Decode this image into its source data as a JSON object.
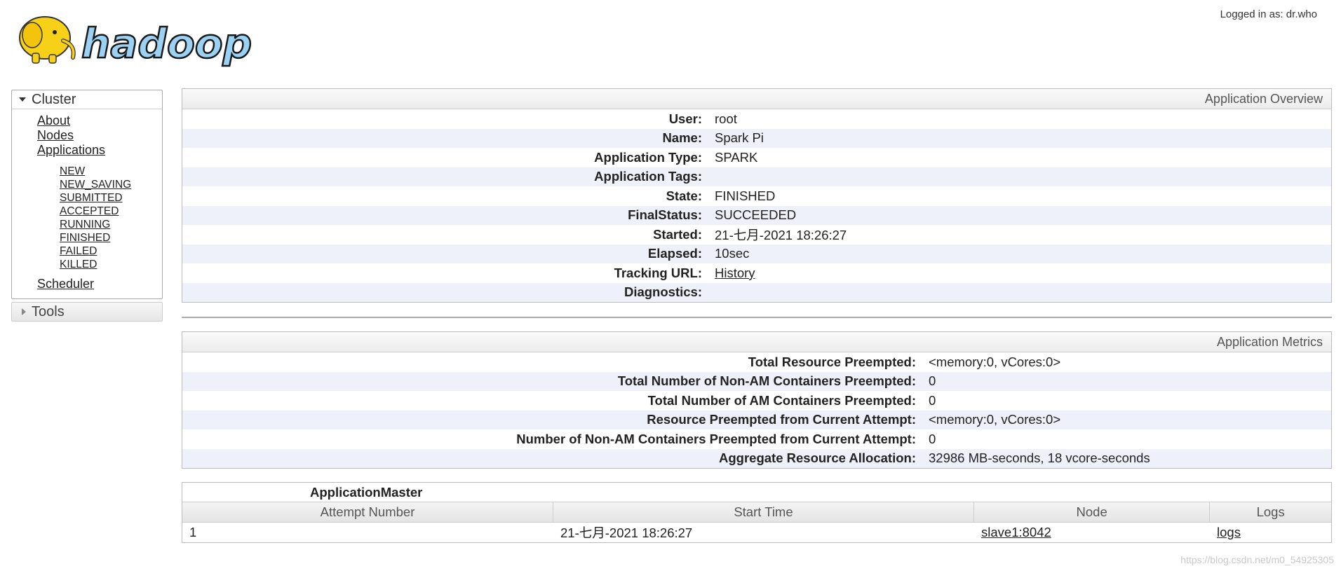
{
  "header": {
    "logo_text": "hadoop",
    "logged_in": "Logged in as: dr.who"
  },
  "nav": {
    "cluster": {
      "title": "Cluster",
      "links": [
        "About",
        "Nodes",
        "Applications"
      ],
      "states": [
        "NEW",
        "NEW_SAVING",
        "SUBMITTED",
        "ACCEPTED",
        "RUNNING",
        "FINISHED",
        "FAILED",
        "KILLED"
      ],
      "scheduler": "Scheduler"
    },
    "tools": {
      "title": "Tools"
    }
  },
  "overview": {
    "title": "Application Overview",
    "rows": [
      {
        "key": "User:",
        "value": "root"
      },
      {
        "key": "Name:",
        "value": "Spark Pi"
      },
      {
        "key": "Application Type:",
        "value": "SPARK"
      },
      {
        "key": "Application Tags:",
        "value": ""
      },
      {
        "key": "State:",
        "value": "FINISHED"
      },
      {
        "key": "FinalStatus:",
        "value": "SUCCEEDED"
      },
      {
        "key": "Started:",
        "value": "21-七月-2021 18:26:27"
      },
      {
        "key": "Elapsed:",
        "value": "10sec"
      },
      {
        "key": "Tracking URL:",
        "value": "History",
        "link": true
      },
      {
        "key": "Diagnostics:",
        "value": ""
      }
    ]
  },
  "metrics": {
    "title": "Application Metrics",
    "rows": [
      {
        "key": "Total Resource Preempted:",
        "value": "<memory:0, vCores:0>"
      },
      {
        "key": "Total Number of Non-AM Containers Preempted:",
        "value": "0"
      },
      {
        "key": "Total Number of AM Containers Preempted:",
        "value": "0"
      },
      {
        "key": "Resource Preempted from Current Attempt:",
        "value": "<memory:0, vCores:0>"
      },
      {
        "key": "Number of Non-AM Containers Preempted from Current Attempt:",
        "value": "0"
      },
      {
        "key": "Aggregate Resource Allocation:",
        "value": "32986 MB-seconds, 18 vcore-seconds"
      }
    ]
  },
  "attempts": {
    "caption": "ApplicationMaster",
    "columns": [
      "Attempt Number",
      "Start Time",
      "Node",
      "Logs"
    ],
    "rows": [
      {
        "attempt": "1",
        "start_time": "21-七月-2021 18:26:27",
        "node": "slave1:8042",
        "logs": "logs"
      }
    ]
  },
  "watermark": "https://blog.csdn.net/m0_54925305"
}
